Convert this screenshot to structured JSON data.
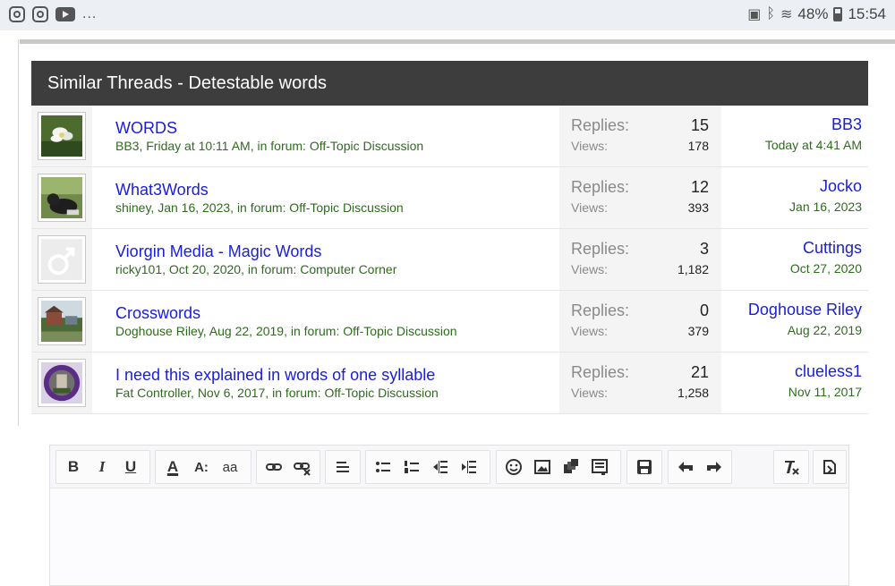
{
  "status_bar": {
    "left_icons": [
      "instagram-icon",
      "instagram-icon",
      "youtube-icon"
    ],
    "more": "...",
    "battery_percent": "48%",
    "time": "15:54"
  },
  "threads": {
    "header": "Similar Threads - Detestable words",
    "replies_label": "Replies:",
    "views_label": "Views:",
    "rows": [
      {
        "title": "WORDS",
        "meta": "BB3, Friday at 10:11 AM, in forum: Off-Topic Discussion",
        "replies": "15",
        "views": "178",
        "last_user": "BB3",
        "last_date": "Today at 4:41 AM",
        "avatar": "flower"
      },
      {
        "title": "What3Words",
        "meta": "shiney, Jan 16, 2023, in forum: Off-Topic Discussion",
        "replies": "12",
        "views": "393",
        "last_user": "Jocko",
        "last_date": "Jan 16, 2023",
        "avatar": "cat"
      },
      {
        "title": "Viorgin Media - Magic Words",
        "meta": "ricky101, Oct 20, 2020, in forum: Computer Corner",
        "replies": "3",
        "views": "1,182",
        "last_user": "Cuttings",
        "last_date": "Oct 27, 2020",
        "avatar": "male-symbol"
      },
      {
        "title": "Crosswords",
        "meta": "Doghouse Riley, Aug 22, 2019, in forum: Off-Topic Discussion",
        "replies": "0",
        "views": "379",
        "last_user": "Doghouse Riley",
        "last_date": "Aug 22, 2019",
        "avatar": "garden"
      },
      {
        "title": "I need this explained in words of one syllable",
        "meta": "Fat Controller, Nov 6, 2017, in forum: Off-Topic Discussion",
        "replies": "21",
        "views": "1,258",
        "last_user": "clueless1",
        "last_date": "Nov 11, 2017",
        "avatar": "badge"
      }
    ]
  },
  "editor": {
    "buttons": {
      "bold": "B",
      "italic": "I",
      "underline": "U",
      "text_color": "A",
      "font_size": "A:",
      "font_family": "aa"
    }
  },
  "colors": {
    "header_bg": "#3d3d3d",
    "link_blue": "#1a20d6",
    "meta_green": "#2f6b1f"
  }
}
